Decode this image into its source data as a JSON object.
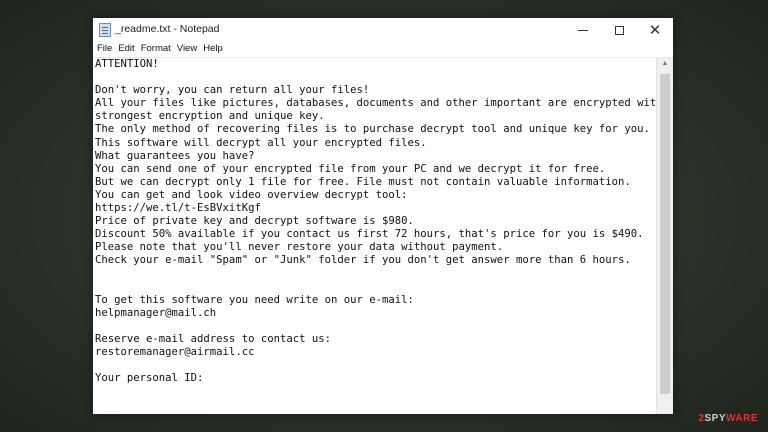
{
  "window": {
    "title": "_readme.txt - Notepad",
    "icon": "notepad-icon",
    "controls": {
      "minimize": "minimize-icon",
      "maximize": "maximize-icon",
      "close_glyph": "✕"
    }
  },
  "menu": [
    "File",
    "Edit",
    "Format",
    "View",
    "Help"
  ],
  "document": {
    "lines": [
      "ATTENTION!",
      "",
      "Don't worry, you can return all your files!",
      "All your files like pictures, databases, documents and other important are encrypted with",
      "strongest encryption and unique key.",
      "The only method of recovering files is to purchase decrypt tool and unique key for you.",
      "This software will decrypt all your encrypted files.",
      "What guarantees you have?",
      "You can send one of your encrypted file from your PC and we decrypt it for free.",
      "But we can decrypt only 1 file for free. File must not contain valuable information.",
      "You can get and look video overview decrypt tool:",
      "https://we.tl/t-EsBVxitKgf",
      "Price of private key and decrypt software is $980.",
      "Discount 50% available if you contact us first 72 hours, that's price for you is $490.",
      "Please note that you'll never restore your data without payment.",
      "Check your e-mail \"Spam\" or \"Junk\" folder if you don't get answer more than 6 hours.",
      "",
      "",
      "To get this software you need write on our e-mail:",
      "helpmanager@mail.ch",
      "",
      "Reserve e-mail address to contact us:",
      "restoremanager@airmail.cc",
      "",
      "Your personal ID:"
    ]
  },
  "watermark": {
    "prefix": "2",
    "middle": "SPY",
    "suffix": "WARE"
  }
}
